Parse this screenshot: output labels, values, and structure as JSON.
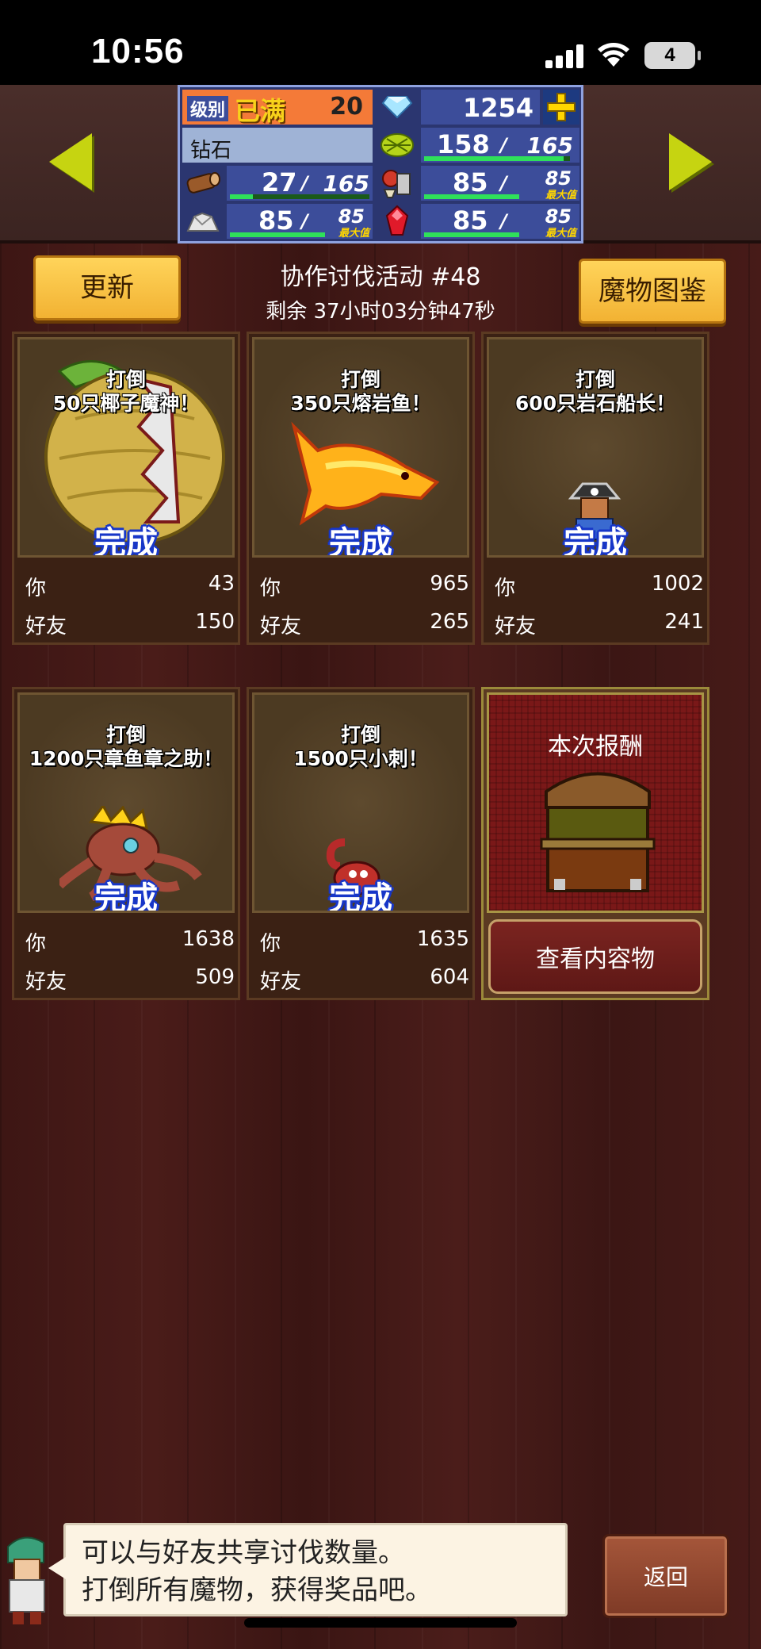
{
  "status_bar": {
    "time": "10:56",
    "battery": "4"
  },
  "stats": {
    "level_label": "级别",
    "level_status": "已满",
    "level": "20",
    "gems": "1254",
    "rank": "钻石",
    "grass_current": "158",
    "grass_max": "165",
    "wood_current": "27",
    "wood_max": "165",
    "food_current": "85",
    "food_max": "85",
    "food_max_label": "最大值",
    "ore_current": "85",
    "ore_max": "85",
    "ore_max_label": "最大值",
    "ruby_current": "85",
    "ruby_max": "85",
    "ruby_max_label": "最大值",
    "slash": "/",
    "progress": {
      "grass": 0.958,
      "wood": 0.164,
      "food": 1.0,
      "ore": 1.0,
      "ruby": 1.0
    }
  },
  "header": {
    "refresh_label": "更新",
    "bestiary_label": "魔物图鉴",
    "event_title": "协作讨伐活动 #48",
    "remaining": "剩余 37小时03分钟47秒"
  },
  "labels": {
    "you": "你",
    "friend": "好友",
    "done": "完成",
    "defeat": "打倒"
  },
  "cards": [
    {
      "goal": "50只椰子魔神！",
      "you": "43",
      "friend": "150"
    },
    {
      "goal": "350只熔岩鱼！",
      "you": "965",
      "friend": "265"
    },
    {
      "goal": "600只岩石船长！",
      "you": "1002",
      "friend": "241"
    },
    {
      "goal": "1200只章鱼章之助！",
      "you": "1638",
      "friend": "509"
    },
    {
      "goal": "1500只小刺！",
      "you": "1635",
      "friend": "604"
    }
  ],
  "reward": {
    "title": "本次报酬",
    "view_label": "查看内容物"
  },
  "speech": {
    "line1": "可以与好友共享讨伐数量。",
    "line2": "打倒所有魔物，获得奖品吧。"
  },
  "back_label": "返回",
  "colors": {
    "bar_fill": "#2fe05a",
    "done_outline": "#1736c8",
    "arrow": "#c6d411"
  }
}
